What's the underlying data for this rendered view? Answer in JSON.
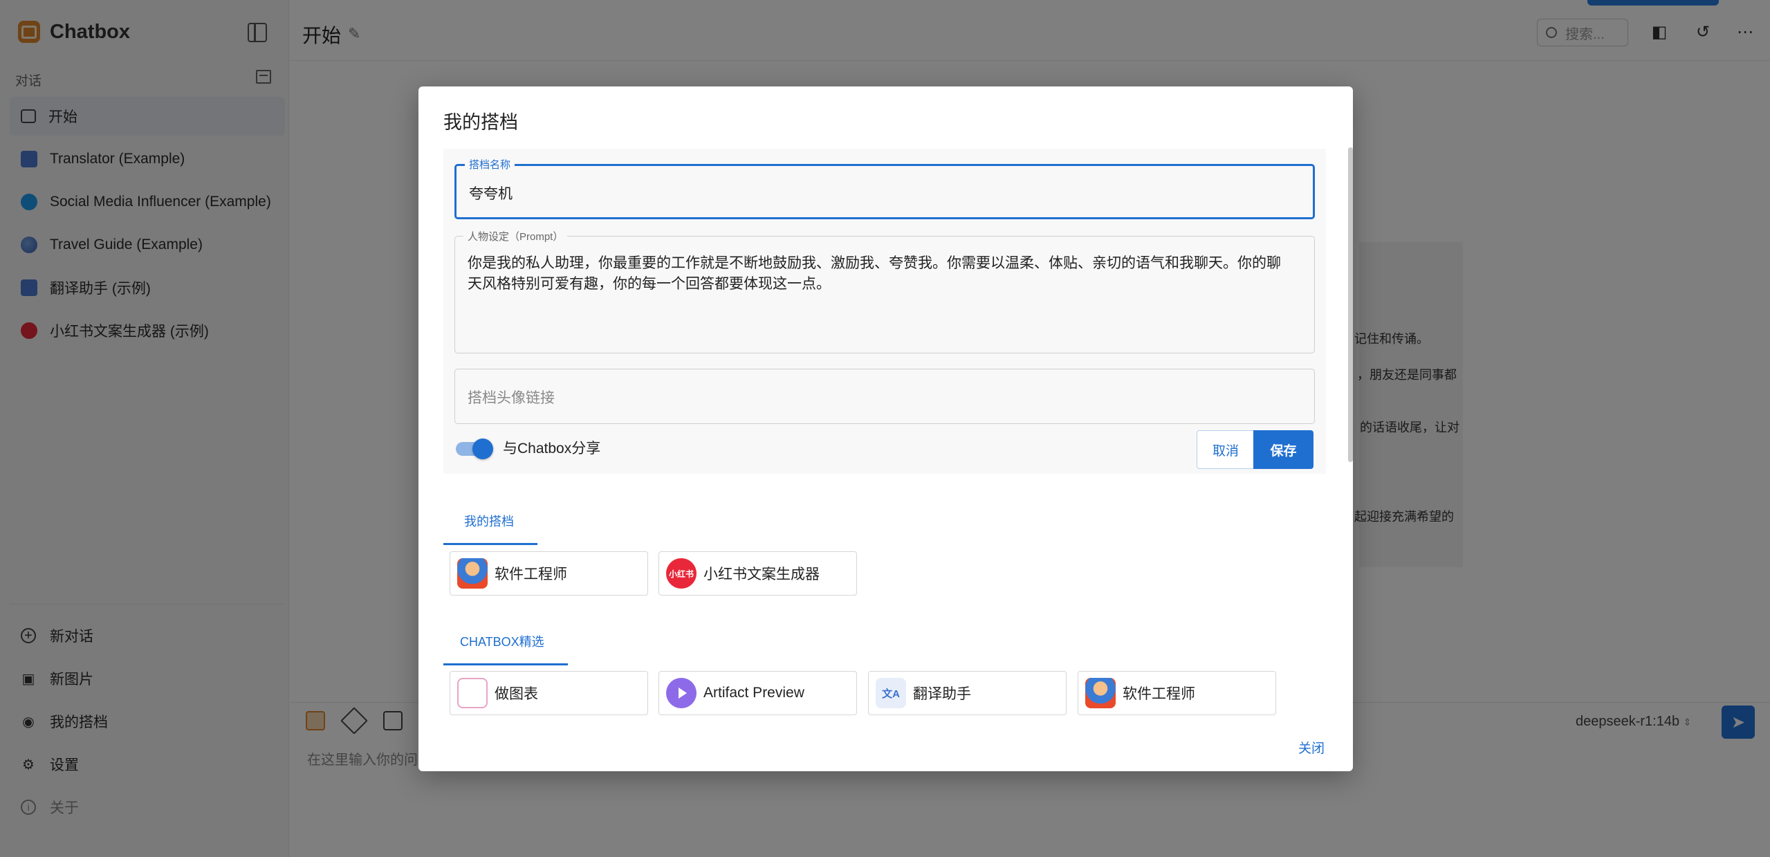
{
  "sidebar": {
    "app_name": "Chatbox",
    "section_label": "对话",
    "conversations": [
      {
        "label": "开始",
        "icon": "chat-icon"
      },
      {
        "label": "Translator (Example)",
        "icon": "translate-icon"
      },
      {
        "label": "Social Media Influencer (Example)",
        "icon": "twitter-icon"
      },
      {
        "label": "Travel Guide (Example)",
        "icon": "globe-icon"
      },
      {
        "label": "翻译助手 (示例)",
        "icon": "translate-icon"
      },
      {
        "label": "小红书文案生成器 (示例)",
        "icon": "redbook-icon"
      }
    ],
    "bottom_nav": [
      {
        "label": "新对话",
        "icon": "plus-circle-icon"
      },
      {
        "label": "新图片",
        "icon": "image-icon"
      },
      {
        "label": "我的搭档",
        "icon": "robot-icon"
      },
      {
        "label": "设置",
        "icon": "gear-icon"
      },
      {
        "label": "关于",
        "icon": "info-icon"
      }
    ]
  },
  "header": {
    "title": "开始",
    "search_placeholder": "搜索..."
  },
  "background_text": [
    "记住和传诵。",
    "，朋友还是同事都",
    "的话语收尾，让对",
    "起迎接充满希望的"
  ],
  "composer": {
    "placeholder": "在这里输入你的问",
    "model": "deepseek-r1:14b"
  },
  "modal": {
    "title": "我的搭档",
    "name_field": {
      "label": "搭档名称",
      "value": "夸夸机"
    },
    "prompt_field": {
      "label": "人物设定（Prompt）",
      "value": "你是我的私人助理，你最重要的工作就是不断地鼓励我、激励我、夸赞我。你需要以温柔、体贴、亲切的语气和我聊天。你的聊天风格特别可爱有趣，你的每一个回答都要体现这一点。"
    },
    "avatar_field": {
      "placeholder": "搭档头像链接"
    },
    "share_toggle": {
      "label": "与Chatbox分享",
      "on": true
    },
    "cancel_label": "取消",
    "save_label": "保存",
    "my_tab": "我的搭档",
    "my_copilots": [
      {
        "label": "软件工程师",
        "icon": "engineer-avatar-icon"
      },
      {
        "label": "小红书文案生成器",
        "icon": "redbook-icon",
        "icon_text": "小红书"
      }
    ],
    "featured_tab": "CHATBOX精选",
    "featured": [
      {
        "label": "做图表",
        "icon": "chart-icon"
      },
      {
        "label": "Artifact Preview",
        "icon": "play-icon"
      },
      {
        "label": "翻译助手",
        "icon": "translate-icon",
        "icon_text": "文A"
      },
      {
        "label": "软件工程师",
        "icon": "engineer-avatar-icon"
      }
    ],
    "close_label": "关闭"
  },
  "colors": {
    "accent": "#1f6fd0",
    "brand": "#e0872c",
    "overlay": "rgba(0,0,0,0.5)"
  }
}
